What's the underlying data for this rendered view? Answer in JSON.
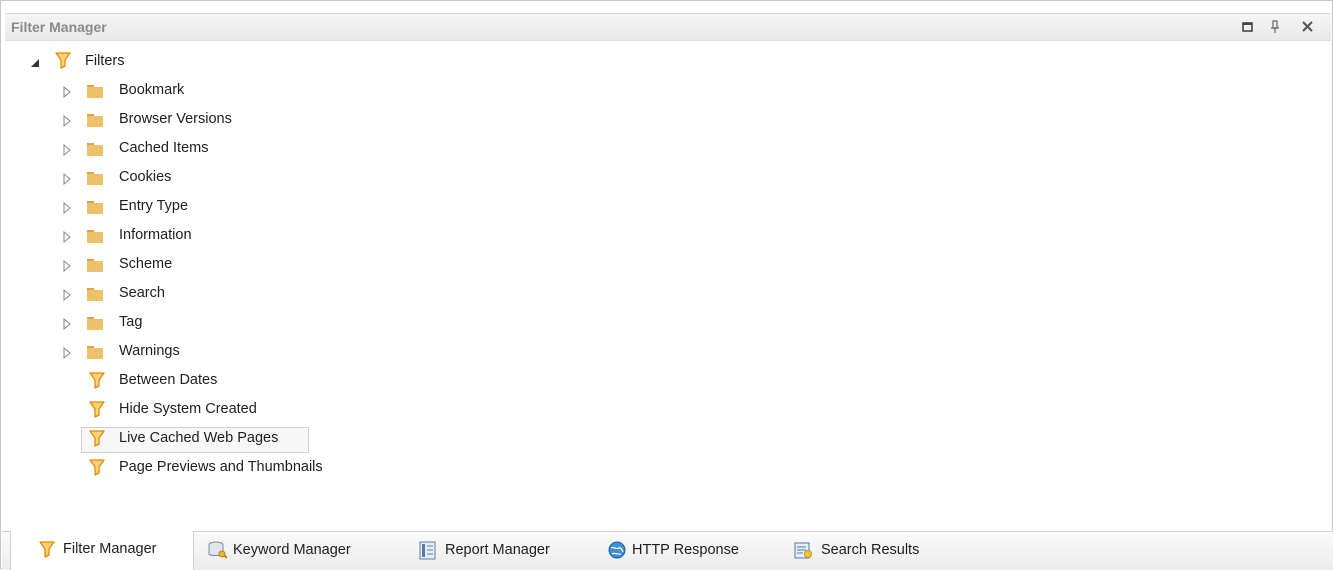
{
  "window": {
    "title": "Filter Manager",
    "buttons": [
      "maximize",
      "pin",
      "close"
    ]
  },
  "tree": {
    "root": {
      "label": "Filters",
      "icon": "funnel-icon",
      "expanded": true
    },
    "folders": [
      {
        "label": "Bookmark"
      },
      {
        "label": "Browser Versions"
      },
      {
        "label": "Cached Items"
      },
      {
        "label": "Cookies"
      },
      {
        "label": "Entry Type"
      },
      {
        "label": "Information"
      },
      {
        "label": "Scheme"
      },
      {
        "label": "Search"
      },
      {
        "label": "Tag"
      },
      {
        "label": "Warnings"
      }
    ],
    "filters": [
      {
        "label": "Between Dates"
      },
      {
        "label": "Hide System Created"
      },
      {
        "label": "Live Cached Web Pages",
        "selected": true
      },
      {
        "label": "Page Previews and Thumbnails"
      }
    ]
  },
  "tabs": [
    {
      "label": "Filter Manager",
      "icon": "funnel-icon",
      "active": true
    },
    {
      "label": "Keyword Manager",
      "icon": "database-key-icon"
    },
    {
      "label": "Report Manager",
      "icon": "report-icon"
    },
    {
      "label": "HTTP Response",
      "icon": "globe-icon"
    },
    {
      "label": "Search Results",
      "icon": "search-results-icon"
    }
  ],
  "colors": {
    "folder": "#e8b85a",
    "funnel": "#f2a21b",
    "title_text": "#8a8a8a"
  }
}
